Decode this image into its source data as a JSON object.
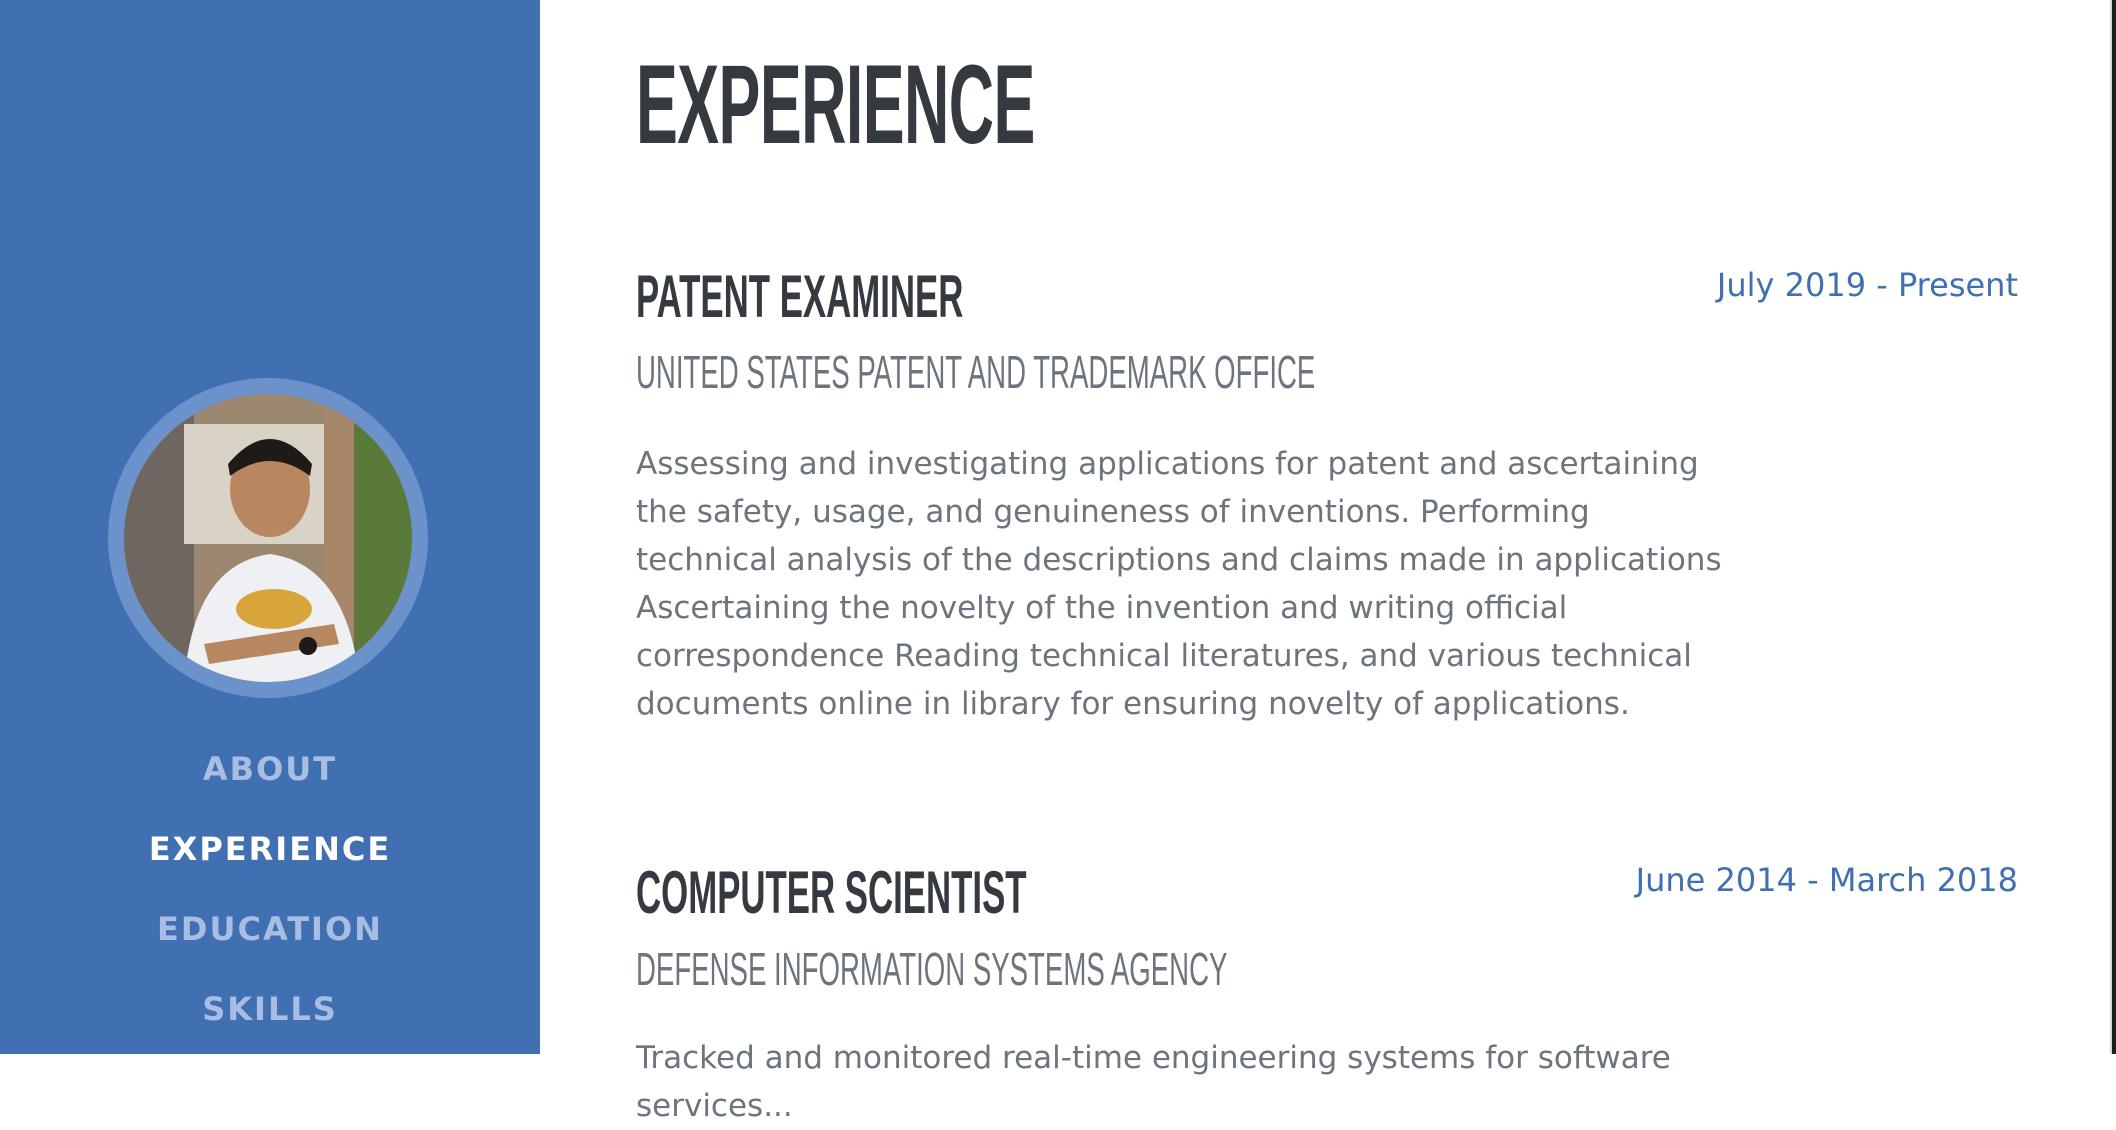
{
  "sidebar": {
    "nav": [
      {
        "label": "ABOUT",
        "active": false
      },
      {
        "label": "EXPERIENCE",
        "active": true
      },
      {
        "label": "EDUCATION",
        "active": false
      },
      {
        "label": "SKILLS",
        "active": false
      }
    ],
    "accent_color": "#4170b2"
  },
  "main": {
    "title": "EXPERIENCE",
    "jobs": [
      {
        "title": "PATENT EXAMINER",
        "org": "UNITED STATES PATENT AND TRADEMARK OFFICE",
        "date": "July 2019 - Present",
        "description": "Assessing and investigating applications for patent and ascertaining the safety, usage, and genuineness of inventions. Performing technical analysis of the descriptions and claims made in applications Ascertaining the novelty of the invention and writing official correspondence Reading technical literatures, and various technical documents online in library for ensuring novelty of applications."
      },
      {
        "title": "COMPUTER SCIENTIST",
        "org": "DEFENSE INFORMATION SYSTEMS AGENCY",
        "date": "June 2014 - March 2018",
        "description": "Tracked and monitored real-time engineering systems for software services..."
      }
    ]
  }
}
